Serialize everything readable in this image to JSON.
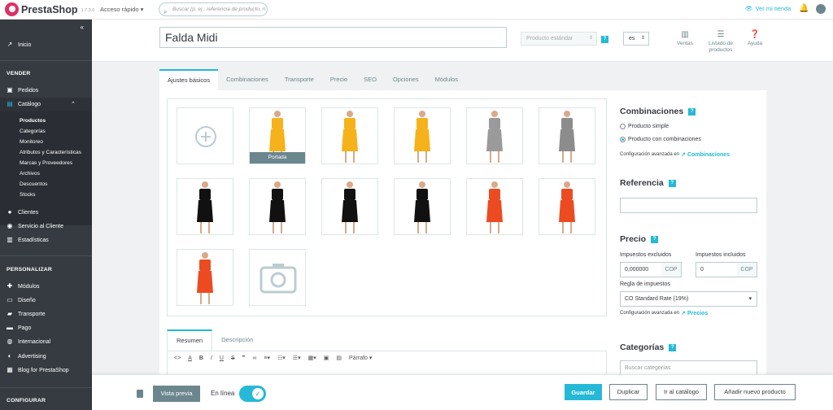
{
  "topbar": {
    "brand": "PrestaShop",
    "version": "1.7.3.0",
    "quick_access": "Acceso rápido",
    "search_placeholder": "Buscar (p. ej.: referencia de producto, n",
    "view_shop": "Ver mi tienda"
  },
  "sidebar": {
    "home": "Inicio",
    "section_sell": "VENDER",
    "orders": "Pedidos",
    "catalog": "Catálogo",
    "catalog_sub": [
      "Productos",
      "Categorías",
      "Monitoreo",
      "Atributos y Características",
      "Marcas y Proveedores",
      "Archivos",
      "Descuentos",
      "Stocks"
    ],
    "customers": "Clientes",
    "customer_service": "Servicio al Cliente",
    "stats": "Estadísticas",
    "section_customize": "PERSONALIZAR",
    "customize_items": [
      "Módulos",
      "Diseño",
      "Transporte",
      "Pago",
      "Internacional",
      "Advertising",
      "Blog for PrestaShop"
    ],
    "section_configure": "CONFIGURAR"
  },
  "header": {
    "product_name": "Falda Midi",
    "product_type": "Producto estándar",
    "language": "es",
    "sales": "Ventas",
    "product_list_1": "Listado de",
    "product_list_2": "productos",
    "help": "Ayuda"
  },
  "tabs": [
    "Ajustes básicos",
    "Combinaciones",
    "Transporte",
    "Precio",
    "SEO",
    "Opciones",
    "Módulos"
  ],
  "gallery": {
    "cover_label": "Portada",
    "colors": [
      "#f6b21b",
      "#f6b21b",
      "#f6b21b",
      "#9a9a9a",
      "#8c8c8c",
      "#111111",
      "#111111",
      "#111111",
      "#111111",
      "#ec4b22",
      "#ec4b22",
      "#ec4b22"
    ]
  },
  "subtabs": [
    "Resumen",
    "Descripción"
  ],
  "editor": {
    "format": "Párrafo"
  },
  "right": {
    "combinations_title": "Combinaciones",
    "simple_product": "Producto simple",
    "with_combinations": "Producto con combinaciones",
    "advanced_config": "Configuración avanzada en",
    "combinations_link": "Combinaciones",
    "reference_title": "Referencia",
    "price_title": "Precio",
    "tax_excluded": "Impuestos excluidos",
    "tax_included": "Impuestos incluidos",
    "price_excl_value": "0,000000",
    "price_incl_value": "0",
    "currency": "COP",
    "tax_rule_label": "Regla de impuestos",
    "tax_rule_value": "CO Standard Rate (19%)",
    "prices_link": "Precios",
    "categories_title": "Categorías",
    "search_categories": "Buscar categorías"
  },
  "footer": {
    "preview": "Vista previa",
    "online": "En línea",
    "save": "Guardar",
    "duplicate": "Duplicar",
    "go_catalog": "Ir al catálogo",
    "add_new": "Añadir nuevo producto"
  },
  "colors": {
    "accent": "#25b9d7",
    "sidebar": "#363a41",
    "brand": "#de3163"
  }
}
